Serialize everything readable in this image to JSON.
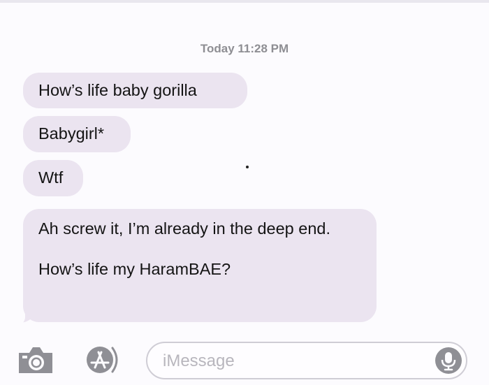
{
  "header": {
    "timestamp": "Today 11:28 PM"
  },
  "messages": [
    {
      "text": "How’s life baby gorilla",
      "direction": "incoming"
    },
    {
      "text": "Babygirl*",
      "direction": "incoming"
    },
    {
      "text": "Wtf",
      "direction": "incoming"
    },
    {
      "text": "Ah screw it, I’m already in the deep end.\n\nHow’s life my HaramBAE?",
      "direction": "incoming"
    }
  ],
  "input_bar": {
    "placeholder": "iMessage",
    "icons": [
      "camera-icon",
      "app-store-icon",
      "microphone-icon"
    ]
  },
  "colors": {
    "bubble": "#ebe4f0",
    "timestamp": "#8e8e93",
    "icon": "#8f8f95"
  }
}
